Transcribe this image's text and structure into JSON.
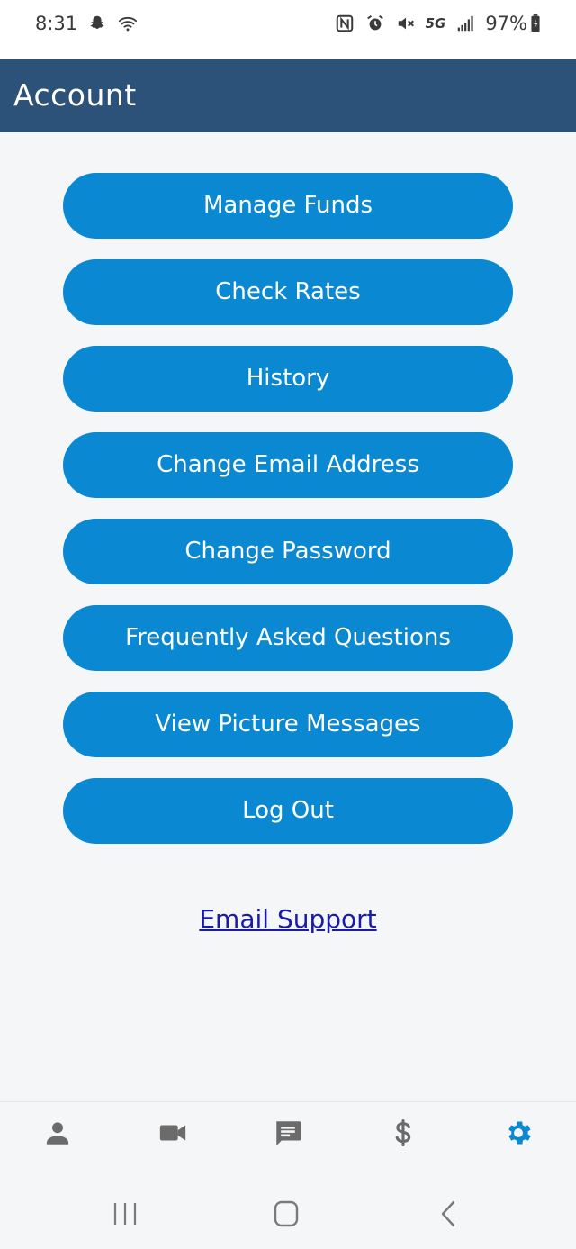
{
  "status_bar": {
    "time": "8:31",
    "network": "5G",
    "battery_percent": "97%",
    "icons_left": [
      "snapchat-icon",
      "wifi-icon"
    ],
    "icons_right": [
      "nfc-icon",
      "alarm-icon",
      "mute-icon",
      "signal-icon",
      "battery-icon"
    ]
  },
  "header": {
    "title": "Account",
    "background_color": "#2c5279"
  },
  "menu": {
    "button_color": "#0a88d1",
    "items": [
      {
        "label": "Manage Funds"
      },
      {
        "label": "Check Rates"
      },
      {
        "label": "History"
      },
      {
        "label": "Change Email Address"
      },
      {
        "label": "Change Password"
      },
      {
        "label": "Frequently Asked Questions"
      },
      {
        "label": "View Picture Messages"
      },
      {
        "label": "Log Out"
      }
    ]
  },
  "support": {
    "label": "Email Support"
  },
  "tab_bar": {
    "active_color": "#0a88d1",
    "inactive_color": "#6b6b6b",
    "tabs": [
      {
        "icon": "person-icon",
        "active": false
      },
      {
        "icon": "video-icon",
        "active": false
      },
      {
        "icon": "message-icon",
        "active": false
      },
      {
        "icon": "dollar-icon",
        "active": false
      },
      {
        "icon": "gear-icon",
        "active": true
      }
    ]
  },
  "nav_bar": {
    "buttons": [
      "recent-apps-icon",
      "home-icon",
      "back-icon"
    ]
  }
}
